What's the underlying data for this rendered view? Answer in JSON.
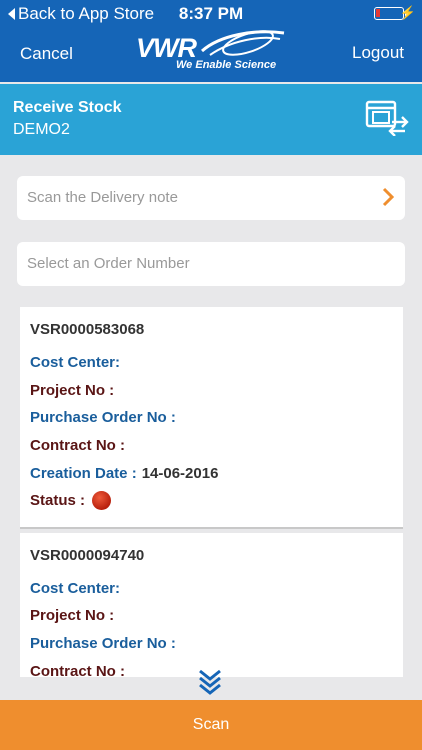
{
  "status_bar": {
    "back": "Back to App Store",
    "time": "8:37 PM"
  },
  "nav": {
    "cancel": "Cancel",
    "logout": "Logout",
    "logo_text": "VWR",
    "logo_tagline": "We Enable Science"
  },
  "section": {
    "title": "Receive Stock",
    "subtitle": "DEMO2",
    "icon": "receive-stock-icon"
  },
  "fields": {
    "delivery_note_placeholder": "Scan the Delivery note",
    "order_number_placeholder": "Select an Order Number"
  },
  "colors": {
    "header": "#1565b7",
    "section": "#2aa3d6",
    "accent": "#ef8e2e",
    "label_blue": "#1a5e9c",
    "label_maroon": "#5a1515",
    "status_red": "#c62810"
  },
  "orders": [
    {
      "number": "VSR0000583068",
      "cost_center_label": "Cost Center:",
      "project_label": "Project No :",
      "po_label": "Purchase Order No :",
      "contract_label": "Contract No :",
      "creation_label": "Creation Date :",
      "creation_date": "14-06-2016",
      "status_label": "Status :",
      "status_color": "red"
    },
    {
      "number": "VSR0000094740",
      "cost_center_label": "Cost Center:",
      "project_label": "Project No :",
      "po_label": "Purchase Order No :",
      "contract_label": "Contract No :"
    }
  ],
  "footer": {
    "scan": "Scan"
  }
}
